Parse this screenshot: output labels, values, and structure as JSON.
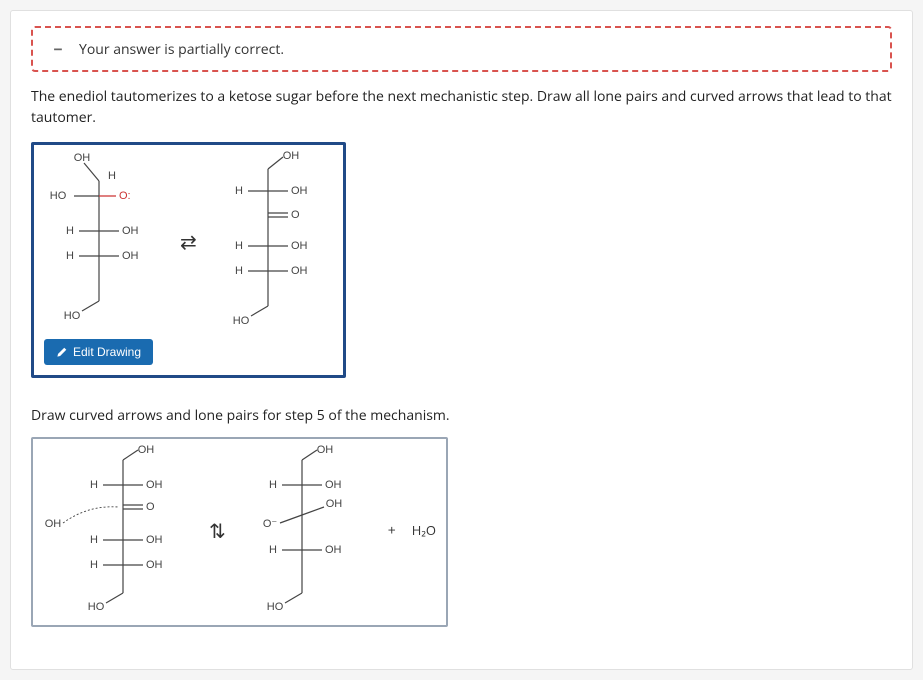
{
  "feedback": {
    "icon": "−",
    "message": "Your answer is partially correct."
  },
  "prompt1": "The enediol tautomerizes to a ketose sugar before the next mechanistic step. Draw all lone pairs and curved arrows that lead to that tautomer.",
  "edit_button": "Edit Drawing",
  "prompt2": "Draw curved arrows and lone pairs for step 5 of the mechanism.",
  "labels": {
    "OH": "OH",
    "H": "H",
    "HO": "HO",
    "O": "O",
    "Ominus": "O",
    "plus": "+",
    "H2O": "H₂O"
  }
}
